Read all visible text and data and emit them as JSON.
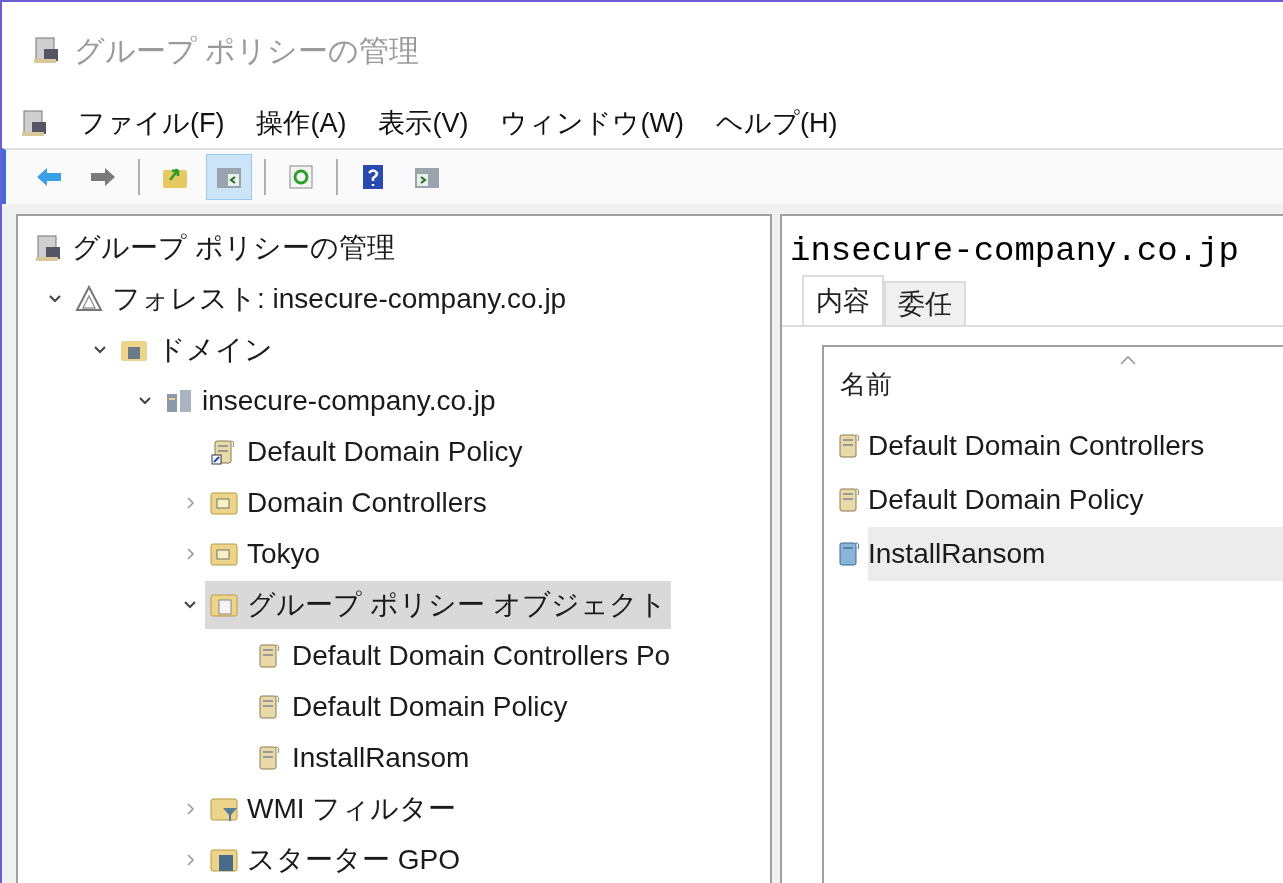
{
  "window": {
    "title": "グループ ポリシーの管理"
  },
  "menu": [
    "ファイル(F)",
    "操作(A)",
    "表示(V)",
    "ウィンドウ(W)",
    "ヘルプ(H)"
  ],
  "toolbar": [
    {
      "kind": "back",
      "selected": false
    },
    {
      "kind": "forward",
      "selected": false
    },
    {
      "kind": "separator"
    },
    {
      "kind": "up",
      "selected": false
    },
    {
      "kind": "tree",
      "selected": true
    },
    {
      "kind": "separator"
    },
    {
      "kind": "refresh",
      "selected": false
    },
    {
      "kind": "separator"
    },
    {
      "kind": "help",
      "selected": false
    },
    {
      "kind": "action-pane",
      "selected": false
    }
  ],
  "tree": [
    {
      "label": "グループ ポリシーの管理",
      "kind": "console",
      "selected": false,
      "children": [
        {
          "label": "フォレスト: insecure-company.co.jp",
          "kind": "forest",
          "expanded": true,
          "selected": false,
          "children": [
            {
              "label": "ドメイン",
              "kind": "domains",
              "expanded": true,
              "selected": false,
              "children": [
                {
                  "label": "insecure-company.co.jp",
                  "kind": "domain",
                  "expanded": true,
                  "selected": false,
                  "children": [
                    {
                      "label": "Default Domain Policy",
                      "kind": "gpo-link",
                      "selected": false
                    },
                    {
                      "label": "Domain Controllers",
                      "kind": "ou",
                      "expanded": false,
                      "selected": false
                    },
                    {
                      "label": "Tokyo",
                      "kind": "ou",
                      "expanded": false,
                      "selected": false
                    },
                    {
                      "label": "グループ ポリシー オブジェクト",
                      "kind": "gpo-folder",
                      "expanded": true,
                      "selected": true,
                      "children": [
                        {
                          "label": "Default Domain Controllers Po",
                          "kind": "gpo",
                          "selected": false
                        },
                        {
                          "label": "Default Domain Policy",
                          "kind": "gpo",
                          "selected": false
                        },
                        {
                          "label": "InstallRansom",
                          "kind": "gpo",
                          "selected": false
                        }
                      ]
                    },
                    {
                      "label": "WMI フィルター",
                      "kind": "wmi",
                      "expanded": false,
                      "selected": false
                    },
                    {
                      "label": "スターター GPO",
                      "kind": "starter",
                      "expanded": false,
                      "selected": false
                    }
                  ]
                }
              ]
            }
          ]
        }
      ]
    }
  ],
  "detail": {
    "title": "insecure-company.co.jp",
    "tabs": [
      {
        "label": "内容",
        "selected": true
      },
      {
        "label": "委任",
        "selected": false
      }
    ],
    "column": "名前",
    "rows": [
      {
        "name": "Default Domain Controllers",
        "kind": "gpo",
        "selected": false
      },
      {
        "name": "Default Domain Policy",
        "kind": "gpo",
        "selected": false
      },
      {
        "name": "InstallRansom",
        "kind": "gpo-blue",
        "selected": true
      }
    ]
  }
}
